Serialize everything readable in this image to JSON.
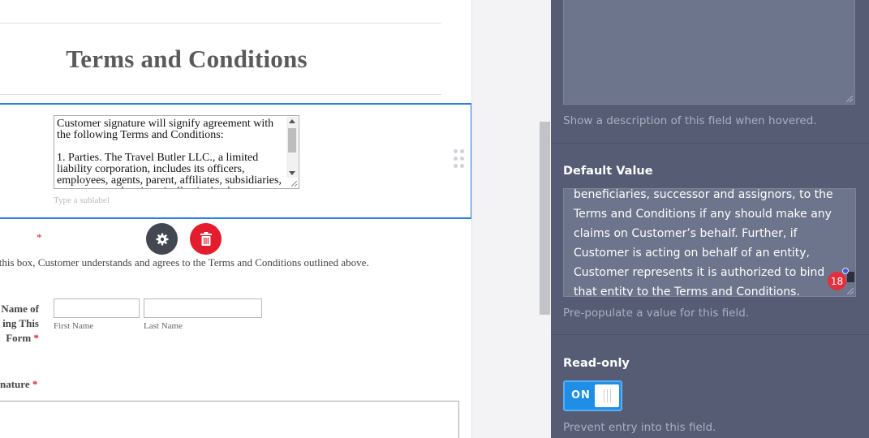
{
  "form": {
    "title": "Terms and Conditions",
    "terms_text": "Customer signature will signify agreement with the following Terms and Conditions:\n\n1. Parties. The Travel Butler LLC., a limited liability corporation, includes its officers, employees, agents, parent, affiliates, subsidiaries, successors and assigns (collectively, the \"Company\")",
    "sublabel_placeholder": "Type a sublabel",
    "required_mark": "*",
    "checkbox_text": "g this box, Customer understands and agrees to the Terms and Conditions outlined above.",
    "name_label": "Name of\ning This\nForm",
    "first_name_sublabel": "First Name",
    "last_name_sublabel": "Last Name",
    "signature_label": "nature"
  },
  "field_actions": {
    "settings_icon": "gear-icon",
    "delete_icon": "trash-icon"
  },
  "properties": {
    "description_help": "Show a description of this field when hovered.",
    "default_value": {
      "title": "Default Value",
      "text": "beneficiaries, successor and assignors, to the Terms and Conditions if any should make any claims on Customer’s behalf. Further, if Customer is acting on behalf of an entity, Customer represents it is authorized to bind that entity to the Terms and Conditions.",
      "badge_count": "18",
      "help": "Pre-populate a value for this field."
    },
    "read_only": {
      "title": "Read-only",
      "toggle_label": "ON",
      "enabled": true,
      "help": "Prevent entry into this field."
    }
  },
  "colors": {
    "accent": "#2b7fe3",
    "panel_bg": "#555c73",
    "delete": "#e31d2e",
    "toggle_on": "#1f8ee6"
  }
}
